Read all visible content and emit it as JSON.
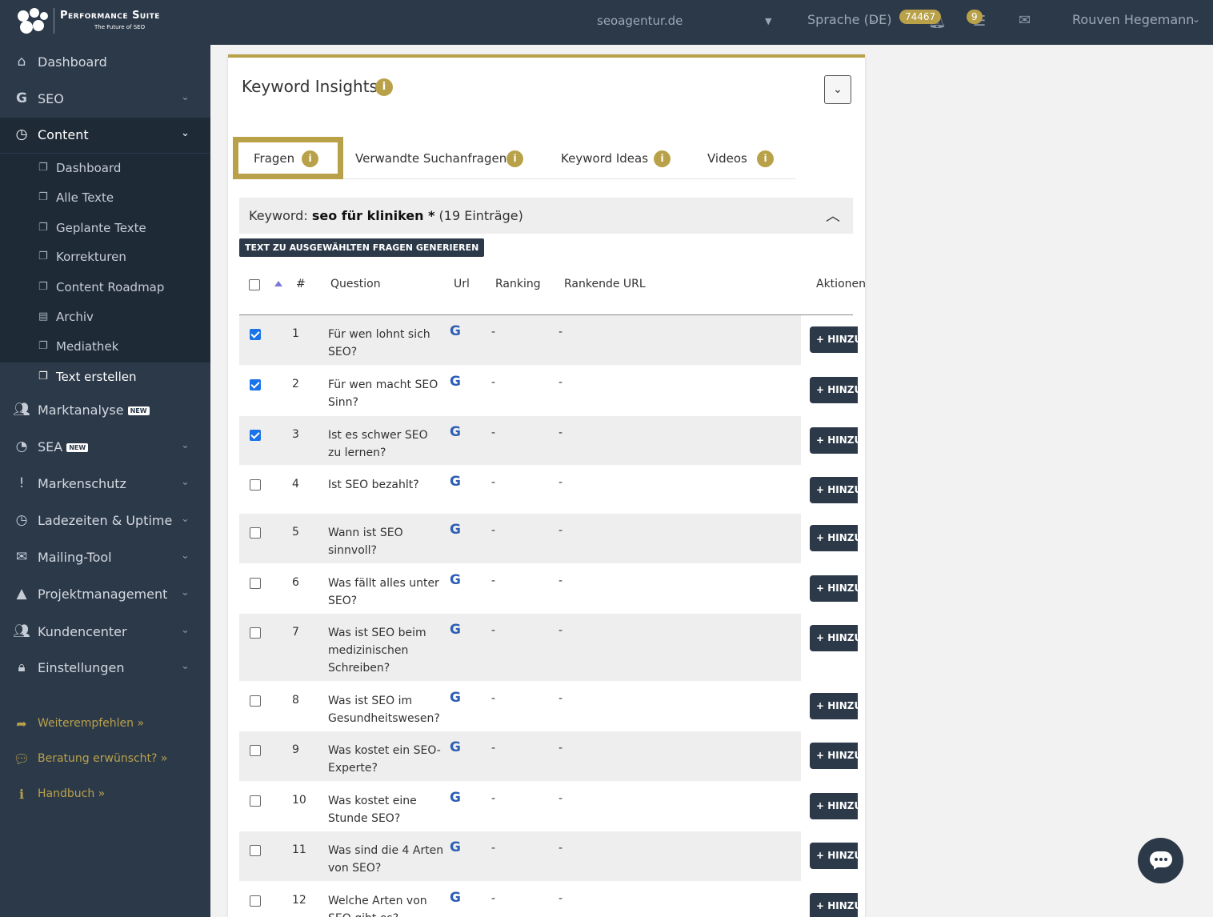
{
  "app": {
    "brand": "Performance Suite",
    "tagline": "The Future of SEO"
  },
  "topbar": {
    "domain": "seoagentur.de",
    "language": "Sprache (DE)",
    "points_badge": "74467",
    "tasks_badge": "9",
    "user": "Rouven Hegemann"
  },
  "sidebar": {
    "items": [
      {
        "label": "Dashboard",
        "icon": "home-icon"
      },
      {
        "label": "SEO",
        "icon": "google-icon"
      },
      {
        "label": "Content",
        "icon": "clock-icon"
      },
      {
        "label": "Marktanalyse",
        "icon": "users-icon",
        "tag": "NEW"
      },
      {
        "label": "SEA",
        "icon": "pie-chart-icon",
        "tag": "NEW"
      },
      {
        "label": "Markenschutz",
        "icon": "exclamation-icon"
      },
      {
        "label": "Ladezeiten & Uptime",
        "icon": "clock-icon"
      },
      {
        "label": "Mailing-Tool",
        "icon": "envelope-icon"
      },
      {
        "label": "Projektmanagement",
        "icon": "road-icon"
      },
      {
        "label": "Kundencenter",
        "icon": "users-icon"
      },
      {
        "label": "Einstellungen",
        "icon": "lock-icon"
      }
    ],
    "content_sub": [
      {
        "label": "Dashboard"
      },
      {
        "label": "Alle Texte"
      },
      {
        "label": "Geplante Texte"
      },
      {
        "label": "Korrekturen"
      },
      {
        "label": "Content Roadmap"
      },
      {
        "label": "Archiv"
      },
      {
        "label": "Mediathek"
      },
      {
        "label": "Text erstellen"
      }
    ],
    "extras": [
      {
        "label": "Weiterempfehlen »",
        "icon": "share-arrow-icon"
      },
      {
        "label": "Beratung erwünscht? »",
        "icon": "chat-icon"
      },
      {
        "label": "Handbuch »",
        "icon": "info-icon"
      }
    ]
  },
  "panel": {
    "title": "Keyword Insights",
    "tabs": [
      {
        "label": "Fragen"
      },
      {
        "label": "Verwandte Suchanfragen"
      },
      {
        "label": "Keyword Ideas"
      },
      {
        "label": "Videos"
      }
    ],
    "keyword_prefix": "Keyword:",
    "keyword": "seo für kliniken *",
    "entries": "(19 Einträge)",
    "generate_button": "TEXT ZU AUSGEWÄHLTEN FRAGEN GENERIEREN",
    "columns": {
      "num": "#",
      "question": "Question",
      "url": "Url",
      "ranking": "Ranking",
      "ranking_url": "Rankende URL",
      "actions": "Aktionen"
    },
    "action_label": "+ HINZUFÜGEN",
    "google_glyph": "G",
    "rows": [
      {
        "num": "1",
        "question": "Für wen lohnt sich SEO?",
        "ranking": "-",
        "ranking_url": "-",
        "checked": true
      },
      {
        "num": "2",
        "question": "Für wen macht SEO Sinn?",
        "ranking": "-",
        "ranking_url": "-",
        "checked": true
      },
      {
        "num": "3",
        "question": "Ist es schwer SEO zu lernen?",
        "ranking": "-",
        "ranking_url": "-",
        "checked": true
      },
      {
        "num": "4",
        "question": "Ist SEO bezahlt?",
        "ranking": "-",
        "ranking_url": "-",
        "checked": false
      },
      {
        "num": "5",
        "question": "Wann ist SEO sinnvoll?",
        "ranking": "-",
        "ranking_url": "-",
        "checked": false
      },
      {
        "num": "6",
        "question": "Was fällt alles unter SEO?",
        "ranking": "-",
        "ranking_url": "-",
        "checked": false
      },
      {
        "num": "7",
        "question": "Was ist SEO beim medizinischen Schreiben?",
        "ranking": "-",
        "ranking_url": "-",
        "checked": false
      },
      {
        "num": "8",
        "question": "Was ist SEO im Gesundheitswesen?",
        "ranking": "-",
        "ranking_url": "-",
        "checked": false
      },
      {
        "num": "9",
        "question": "Was kostet ein SEO-Experte?",
        "ranking": "-",
        "ranking_url": "-",
        "checked": false
      },
      {
        "num": "10",
        "question": "Was kostet eine Stunde SEO?",
        "ranking": "-",
        "ranking_url": "-",
        "checked": false
      },
      {
        "num": "11",
        "question": "Was sind die 4 Arten von SEO?",
        "ranking": "-",
        "ranking_url": "-",
        "checked": false
      },
      {
        "num": "12",
        "question": "Welche Arten von SEO gibt es?",
        "ranking": "-",
        "ranking_url": "-",
        "checked": false
      }
    ]
  },
  "colors": {
    "sidebar_bg": "#2c3949",
    "sidebar_active_bg": "#1f2a37",
    "accent_gold": "#b9a14a",
    "google_blue": "#2e5fb4",
    "checkbox_blue": "#1a73e8"
  }
}
